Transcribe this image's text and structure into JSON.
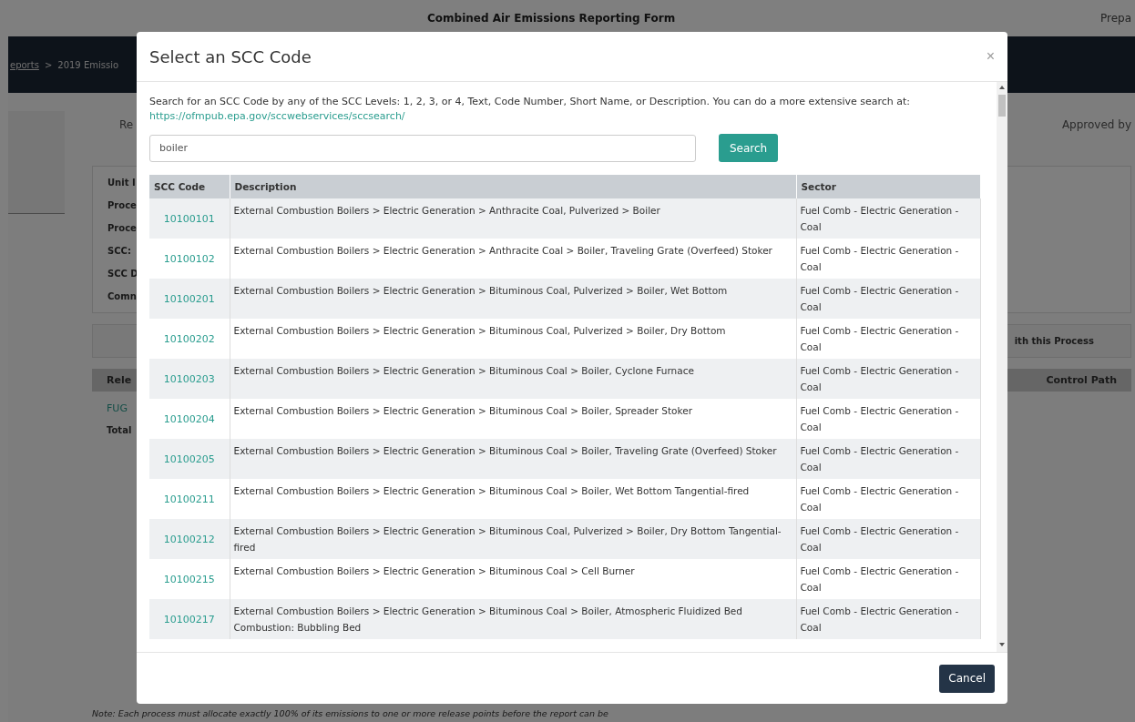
{
  "page": {
    "title": "Combined Air Emissions Reporting Form",
    "preparer": "Prepa",
    "breadcrumbs": [
      {
        "label": "eports",
        "link": true
      },
      {
        "label": ">",
        "link": false
      },
      {
        "label": "2019 Emissio",
        "link": false
      }
    ],
    "status_left": "Re",
    "status_right": "Approved by",
    "field_labels": [
      "Unit I",
      "Proce",
      "Proce",
      "SCC:",
      "SCC D",
      "Comn"
    ],
    "section_heading": "ith this Process",
    "table": {
      "columns": [
        "Rele",
        "Control Path"
      ],
      "row": "FUG",
      "total": "Total"
    },
    "note": "*Note:* Each process must allocate exactly 100% of its emissions to one or more release points before the report can be"
  },
  "modal": {
    "title": "Select an SCC Code",
    "close": "×",
    "intro": "Search for an SCC Code by any of the SCC Levels: 1, 2, 3, or 4, Text, Code Number, Short Name, or Description. You can do a more extensive search at:",
    "link": "https://ofmpub.epa.gov/sccwebservices/sccsearch/",
    "search": {
      "value": "boiler",
      "button": "Search"
    },
    "columns": [
      "SCC Code",
      "Description",
      "Sector"
    ],
    "rows": [
      {
        "code": "10100101",
        "description": "External Combustion Boilers > Electric Generation > Anthracite Coal, Pulverized > Boiler",
        "sector": "Fuel Comb - Electric Generation - Coal"
      },
      {
        "code": "10100102",
        "description": "External Combustion Boilers > Electric Generation > Anthracite Coal > Boiler, Traveling Grate (Overfeed) Stoker",
        "sector": "Fuel Comb - Electric Generation - Coal"
      },
      {
        "code": "10100201",
        "description": "External Combustion Boilers > Electric Generation > Bituminous Coal, Pulverized > Boiler, Wet Bottom",
        "sector": "Fuel Comb - Electric Generation - Coal"
      },
      {
        "code": "10100202",
        "description": "External Combustion Boilers > Electric Generation > Bituminous Coal, Pulverized > Boiler, Dry Bottom",
        "sector": "Fuel Comb - Electric Generation - Coal"
      },
      {
        "code": "10100203",
        "description": "External Combustion Boilers > Electric Generation > Bituminous Coal > Boiler, Cyclone Furnace",
        "sector": "Fuel Comb - Electric Generation - Coal"
      },
      {
        "code": "10100204",
        "description": "External Combustion Boilers > Electric Generation > Bituminous Coal > Boiler, Spreader Stoker",
        "sector": "Fuel Comb - Electric Generation - Coal"
      },
      {
        "code": "10100205",
        "description": "External Combustion Boilers > Electric Generation > Bituminous Coal > Boiler, Traveling Grate (Overfeed) Stoker",
        "sector": "Fuel Comb - Electric Generation - Coal"
      },
      {
        "code": "10100211",
        "description": "External Combustion Boilers > Electric Generation > Bituminous Coal > Boiler, Wet Bottom Tangential-fired",
        "sector": "Fuel Comb - Electric Generation - Coal"
      },
      {
        "code": "10100212",
        "description": "External Combustion Boilers > Electric Generation > Bituminous Coal, Pulverized > Boiler, Dry Bottom Tangential-fired",
        "sector": "Fuel Comb - Electric Generation - Coal"
      },
      {
        "code": "10100215",
        "description": "External Combustion Boilers > Electric Generation > Bituminous Coal > Cell Burner",
        "sector": "Fuel Comb - Electric Generation - Coal"
      },
      {
        "code": "10100217",
        "description": "External Combustion Boilers > Electric Generation > Bituminous Coal > Boiler, Atmospheric Fluidized Bed Combustion: Bubbling Bed",
        "sector": "Fuel Comb - Electric Generation - Coal"
      }
    ],
    "cancel": "Cancel"
  }
}
